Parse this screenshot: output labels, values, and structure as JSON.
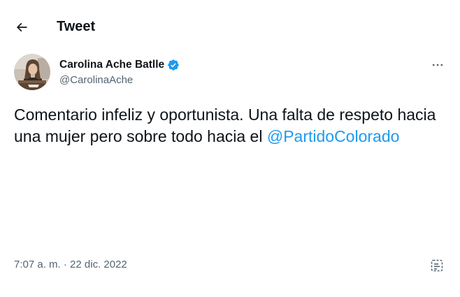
{
  "header": {
    "title": "Tweet",
    "back_icon": "arrow-left-icon"
  },
  "author": {
    "display_name": "Carolina Ache Batlle",
    "handle": "@CarolinaAche",
    "verified": true,
    "verified_color": "#1d9bf0",
    "more_icon": "more-horizontal-icon"
  },
  "tweet": {
    "text_part1": "Comentario infeliz y oportunista. Una falta de respeto hacia una mujer pero sobre todo hacia el ",
    "mention": "@PartidoColorado",
    "time": "7:07 a. m.",
    "separator": " · ",
    "date": "22 dic. 2022",
    "analytics_icon": "analytics-icon"
  },
  "colors": {
    "text": "#0f1419",
    "secondary": "#536471",
    "link": "#1d9bf0",
    "background": "#ffffff"
  }
}
